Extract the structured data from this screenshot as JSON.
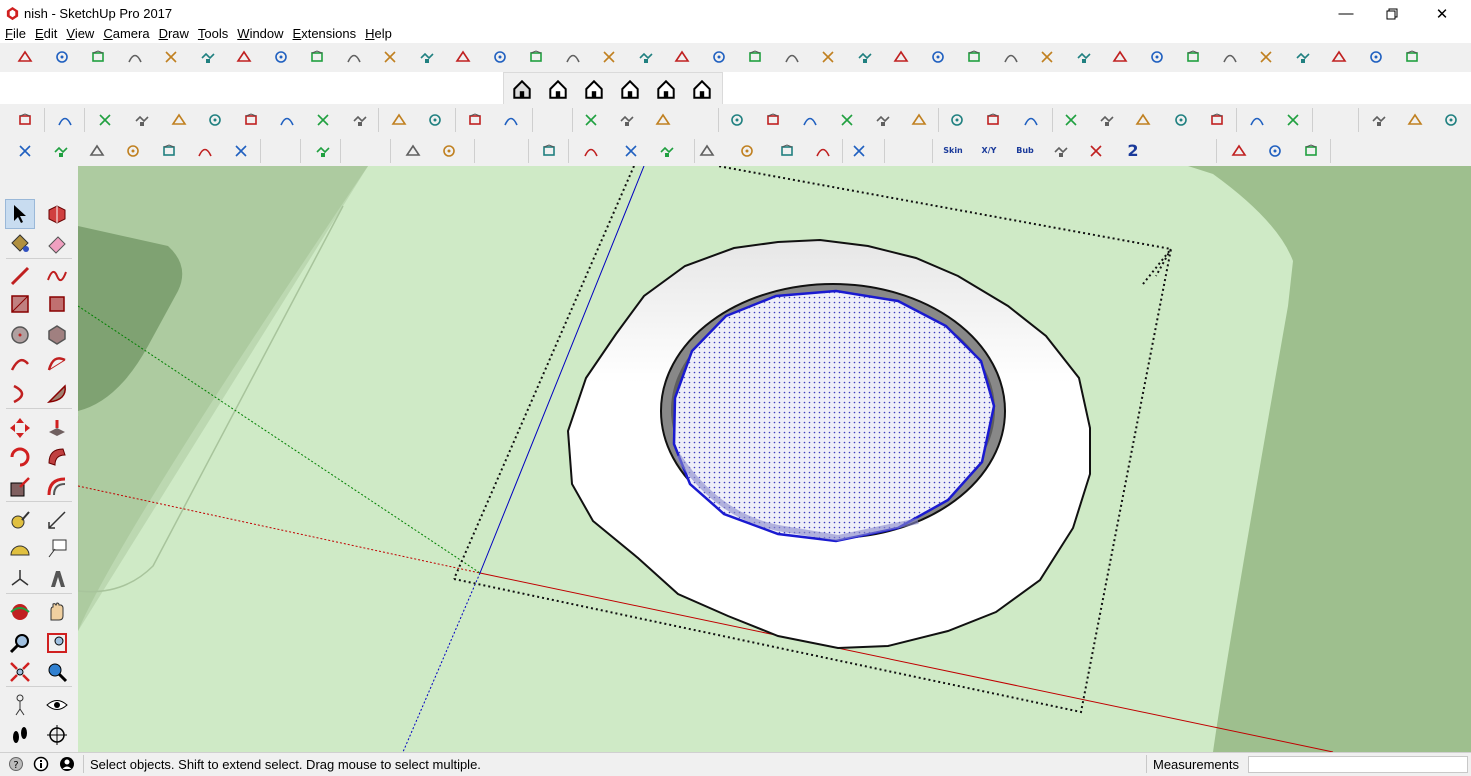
{
  "window": {
    "title": "nish - SketchUp Pro 2017",
    "controls": [
      "minimize-icon",
      "restore-icon",
      "close-icon"
    ]
  },
  "menu": [
    "File",
    "Edit",
    "View",
    "Camera",
    "Draw",
    "Tools",
    "Window",
    "Extensions",
    "Help"
  ],
  "toolbars": {
    "row1_icons": 39,
    "views_row": [
      "iso-view-icon",
      "top-view-icon",
      "front-view-icon",
      "right-view-icon",
      "back-view-icon",
      "left-view-icon"
    ],
    "row3_text_icons": [
      "Skin",
      "X/Y",
      "Bub",
      "2"
    ]
  },
  "tools": [
    [
      "select-icon",
      "make-component-icon"
    ],
    [
      "paint-bucket-icon",
      "eraser-icon"
    ],
    [
      "line-icon",
      "freehand-icon"
    ],
    [
      "rectangle-icon",
      "rotated-rectangle-icon"
    ],
    [
      "circle-icon",
      "polygon-icon"
    ],
    [
      "arc-icon",
      "two-point-arc-icon"
    ],
    [
      "three-point-arc-icon",
      "pie-icon"
    ],
    [
      "move-icon",
      "push-pull-icon"
    ],
    [
      "rotate-icon",
      "follow-me-icon"
    ],
    [
      "scale-icon",
      "offset-icon"
    ],
    [
      "tape-measure-icon",
      "dimension-icon"
    ],
    [
      "protractor-icon",
      "text-icon"
    ],
    [
      "axes-icon",
      "3d-text-icon"
    ],
    [
      "orbit-icon",
      "pan-icon"
    ],
    [
      "zoom-icon",
      "zoom-window-icon"
    ],
    [
      "zoom-extents-icon",
      "previous-view-icon"
    ],
    [
      "position-camera-icon",
      "look-around-icon"
    ],
    [
      "walk-icon",
      "section-plane-icon"
    ]
  ],
  "status": {
    "message": "Select objects. Shift to extend select. Drag mouse to select multiple.",
    "measurements_label": "Measurements",
    "measurements_value": ""
  },
  "colors": {
    "ground": "#9ebf8e",
    "slab": "#cfeac6",
    "ring": "#ffffff",
    "selection_blue": "#1a1ad0",
    "axis_red": "#c00000",
    "axis_blue": "#0000c0",
    "axis_green": "#008000"
  }
}
